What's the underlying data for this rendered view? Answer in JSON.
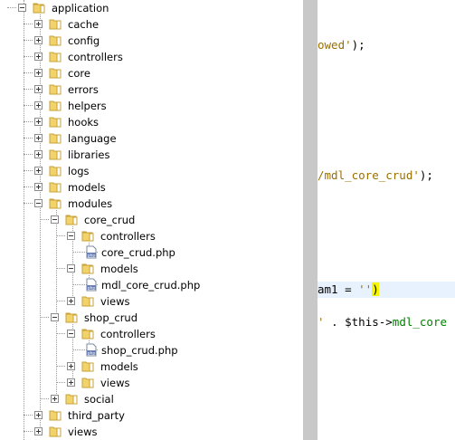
{
  "tree": {
    "items": [
      {
        "label": "application",
        "depth": 1,
        "expanded": true,
        "icon": "folder-open-icon"
      },
      {
        "label": "cache",
        "depth": 2,
        "expanded": false,
        "icon": "folder-icon"
      },
      {
        "label": "config",
        "depth": 2,
        "expanded": false,
        "icon": "folder-icon"
      },
      {
        "label": "controllers",
        "depth": 2,
        "expanded": false,
        "icon": "folder-icon"
      },
      {
        "label": "core",
        "depth": 2,
        "expanded": false,
        "icon": "folder-icon"
      },
      {
        "label": "errors",
        "depth": 2,
        "expanded": false,
        "icon": "folder-icon"
      },
      {
        "label": "helpers",
        "depth": 2,
        "expanded": false,
        "icon": "folder-icon"
      },
      {
        "label": "hooks",
        "depth": 2,
        "expanded": false,
        "icon": "folder-icon"
      },
      {
        "label": "language",
        "depth": 2,
        "expanded": false,
        "icon": "folder-icon"
      },
      {
        "label": "libraries",
        "depth": 2,
        "expanded": false,
        "icon": "folder-icon"
      },
      {
        "label": "logs",
        "depth": 2,
        "expanded": false,
        "icon": "folder-icon"
      },
      {
        "label": "models",
        "depth": 2,
        "expanded": false,
        "icon": "folder-icon"
      },
      {
        "label": "modules",
        "depth": 2,
        "expanded": true,
        "icon": "folder-open-icon"
      },
      {
        "label": "core_crud",
        "depth": 3,
        "expanded": true,
        "icon": "folder-open-icon"
      },
      {
        "label": "controllers",
        "depth": 4,
        "expanded": true,
        "icon": "folder-open-icon"
      },
      {
        "label": "core_crud.php",
        "depth": 5,
        "file": true,
        "icon": "php-file-icon"
      },
      {
        "label": "models",
        "depth": 4,
        "expanded": true,
        "icon": "folder-open-icon"
      },
      {
        "label": "mdl_core_crud.php",
        "depth": 5,
        "file": true,
        "icon": "php-file-icon"
      },
      {
        "label": "views",
        "depth": 4,
        "expanded": false,
        "icon": "folder-icon"
      },
      {
        "label": "shop_crud",
        "depth": 3,
        "expanded": true,
        "icon": "folder-open-icon"
      },
      {
        "label": "controllers",
        "depth": 4,
        "expanded": true,
        "icon": "folder-open-icon"
      },
      {
        "label": "shop_crud.php",
        "depth": 5,
        "file": true,
        "icon": "php-file-icon"
      },
      {
        "label": "models",
        "depth": 4,
        "expanded": false,
        "icon": "folder-icon"
      },
      {
        "label": "views",
        "depth": 4,
        "expanded": false,
        "icon": "folder-icon"
      },
      {
        "label": "social",
        "depth": 3,
        "expanded": false,
        "icon": "folder-icon"
      },
      {
        "label": "third_party",
        "depth": 2,
        "expanded": false,
        "icon": "folder-icon"
      },
      {
        "label": "views",
        "depth": 2,
        "expanded": false,
        "icon": "folder-icon"
      }
    ]
  },
  "editor": {
    "lines": [
      {
        "row": 2,
        "parts": [
          {
            "t": "owed'",
            "c": "str"
          },
          {
            "t": ");",
            "c": "op"
          }
        ]
      },
      {
        "row": 10,
        "parts": [
          {
            "t": "/mdl_core_crud'",
            "c": "str"
          },
          {
            "t": ");",
            "c": "op"
          }
        ]
      },
      {
        "row": 17,
        "highlight": true,
        "parts": [
          {
            "t": "am1 = ",
            "c": "op"
          },
          {
            "t": "''",
            "c": "str"
          },
          {
            "t": ")",
            "c": "brace"
          }
        ]
      },
      {
        "row": 19,
        "parts": [
          {
            "t": "' ",
            "c": "str"
          },
          {
            "t": ". $this->",
            "c": "op"
          },
          {
            "t": "mdl_core",
            "c": "fn"
          }
        ]
      }
    ]
  },
  "colors": {
    "folder": "#f2d36b",
    "folder_edge": "#c9a236",
    "divider": "#c8c8c8",
    "string": "#9a6f00",
    "function": "#008000",
    "brace_highlight": "#f6f600",
    "line_highlight": "#e8f2fe"
  }
}
